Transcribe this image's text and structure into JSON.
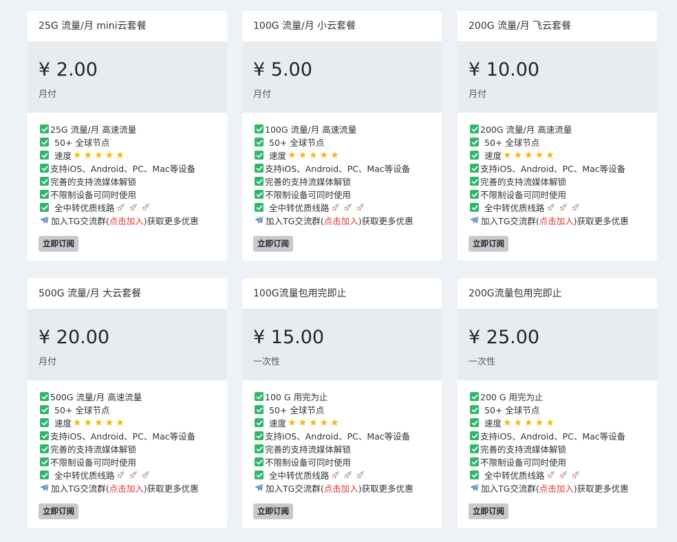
{
  "plans": [
    {
      "title": "25G 流量/月 mini云套餐",
      "price": "¥ 2.00",
      "period": "月付",
      "features": {
        "traffic": "25G 流量/月 高速流量",
        "nodes": "50+ 全球节点",
        "speed": "速度",
        "devices": "支持iOS、Android、PC、Mac等设备",
        "streaming": "完善的支持流媒体解锁",
        "unlimited": "不限制设备可同时使用",
        "relay": "全中转优质线路"
      },
      "tg": {
        "pre": "加入TG交流群(",
        "link": "点击加入",
        "post": ")获取更多优惠"
      },
      "button": "立即订阅"
    },
    {
      "title": "100G 流量/月 小云套餐",
      "price": "¥ 5.00",
      "period": "月付",
      "features": {
        "traffic": "100G 流量/月 高速流量",
        "nodes": "50+ 全球节点",
        "speed": "速度",
        "devices": "支持iOS、Android、PC、Mac等设备",
        "streaming": "完善的支持流媒体解锁",
        "unlimited": "不限制设备可同时使用",
        "relay": "全中转优质线路"
      },
      "tg": {
        "pre": "加入TG交流群(",
        "link": "点击加入",
        "post": ")获取更多优惠"
      },
      "button": "立即订阅"
    },
    {
      "title": "200G 流量/月 飞云套餐",
      "price": "¥ 10.00",
      "period": "月付",
      "features": {
        "traffic": "200G 流量/月 高速流量",
        "nodes": "50+ 全球节点",
        "speed": "速度",
        "devices": "支持iOS、Android、PC、Mac等设备",
        "streaming": "完善的支持流媒体解锁",
        "unlimited": "不限制设备可同时使用",
        "relay": "全中转优质线路"
      },
      "tg": {
        "pre": "加入TG交流群(",
        "link": "点击加入",
        "post": ")获取更多优惠"
      },
      "button": "立即订阅"
    },
    {
      "title": "500G 流量/月 大云套餐",
      "price": "¥ 20.00",
      "period": "月付",
      "features": {
        "traffic": "500G 流量/月 高速流量",
        "nodes": "50+ 全球节点",
        "speed": "速度",
        "devices": "支持iOS、Android、PC、Mac等设备",
        "streaming": "完善的支持流媒体解锁",
        "unlimited": "不限制设备可同时使用",
        "relay": "全中转优质线路"
      },
      "tg": {
        "pre": "加入TG交流群(",
        "link": "点击加入",
        "post": ")获取更多优惠"
      },
      "button": "立即订阅"
    },
    {
      "title": "100G流量包用完即止",
      "price": "¥ 15.00",
      "period": "一次性",
      "features": {
        "traffic": "100 G 用完为止",
        "nodes": "50+ 全球节点",
        "speed": "速度",
        "devices": "支持iOS、Android、PC、Mac等设备",
        "streaming": "完善的支持流媒体解锁",
        "unlimited": "不限制设备可同时使用",
        "relay": "全中转优质线路"
      },
      "tg": {
        "pre": "加入TG交流群(",
        "link": "点击加入",
        "post": ")获取更多优惠"
      },
      "button": "立即订阅"
    },
    {
      "title": "200G流量包用完即止",
      "price": "¥ 25.00",
      "period": "一次性",
      "features": {
        "traffic": "200 G 用完为止",
        "nodes": "50+ 全球节点",
        "speed": "速度",
        "devices": "支持iOS、Android、PC、Mac等设备",
        "streaming": "完善的支持流媒体解锁",
        "unlimited": "不限制设备可同时使用",
        "relay": "全中转优质线路"
      },
      "tg": {
        "pre": "加入TG交流群(",
        "link": "点击加入",
        "post": ")获取更多优惠"
      },
      "button": "立即订阅"
    }
  ],
  "speed_rating": 5,
  "relay_rockets": 3,
  "icons": {
    "check": "check-box-icon",
    "star": "star-icon",
    "rocket": "rocket-icon",
    "plane": "airplane-icon"
  },
  "colors": {
    "check": "#2fb66b",
    "star": "#f5b70a",
    "link": "#e3342f",
    "button": "#c6c9cd",
    "price_bg": "#e9ecef"
  }
}
